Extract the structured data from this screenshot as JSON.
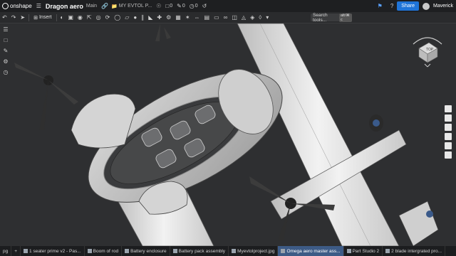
{
  "topbar": {
    "app_name": "onshape",
    "doc_title": "Dragon aero",
    "workspace": "Main",
    "breadcrumb": "MY EVTOL P...",
    "count_a": "0",
    "count_b": "0",
    "count_c": "0",
    "share_label": "Share",
    "user_name": "Maverick"
  },
  "toolbar": {
    "insert_label": "Insert",
    "search_placeholder": "Search tools...",
    "search_shortcut": "alt/⌘ c"
  },
  "viewcube": {
    "face_label": "TOP"
  },
  "tabs": [
    {
      "label": "1 seater prime v2 - Pas..."
    },
    {
      "label": "Boom of rod"
    },
    {
      "label": "Battery enclosure"
    },
    {
      "label": "Battery pack assembly"
    },
    {
      "label": "Myevtolproject.jpg"
    },
    {
      "label": "Omega aero master ass..."
    },
    {
      "label": "Part Studio 2"
    },
    {
      "label": "2 blade intergrated pro..."
    }
  ],
  "tab_partial_left": "pg",
  "colors": {
    "accent": "#1f74d8",
    "active_tab": "#3d5b86",
    "background": "#2e2f31"
  }
}
